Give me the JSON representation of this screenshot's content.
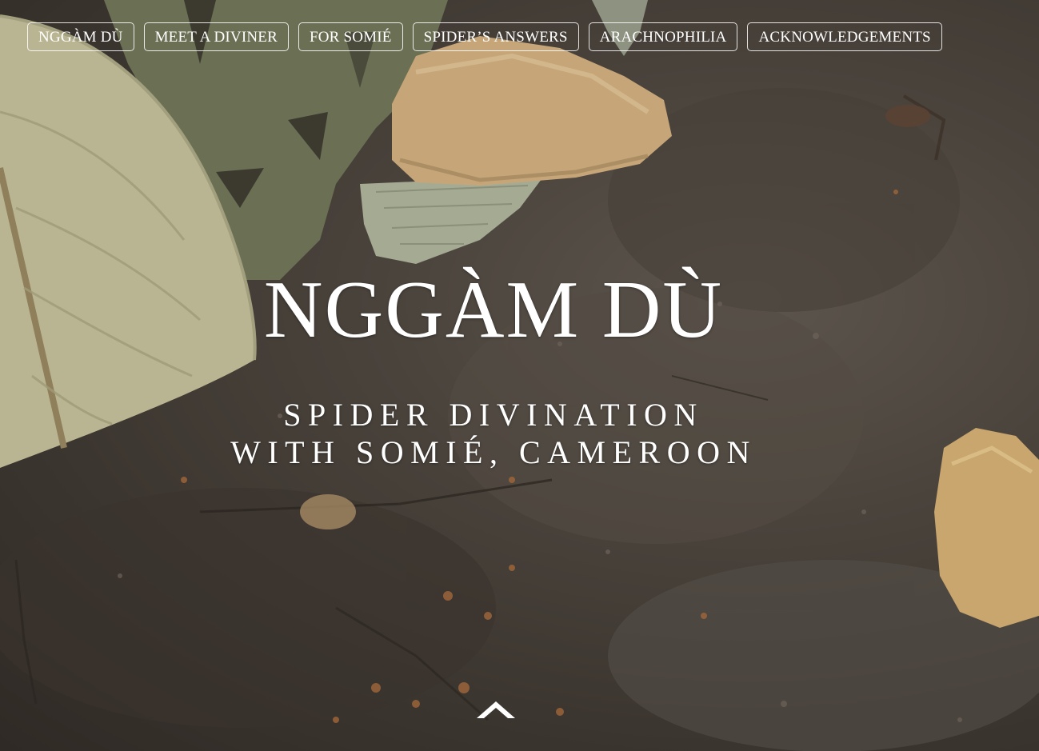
{
  "nav": {
    "items": [
      {
        "label": "NGGÀM DÙ"
      },
      {
        "label": "MEET A DIVINER"
      },
      {
        "label": "FOR SOMIÉ"
      },
      {
        "label": "SPIDER’S ANSWERS"
      },
      {
        "label": "ARACHNOPHILIA"
      },
      {
        "label": "ACKNOWLEDGEMENTS"
      }
    ]
  },
  "hero": {
    "title": "NGGÀM DÙ",
    "subtitle_line1": "SPIDER DIVINATION",
    "subtitle_line2": "WITH SOMIÉ, CAMEROON"
  },
  "icons": {
    "scroll": "chevron-up-icon"
  },
  "colors": {
    "text": "#ffffff",
    "soil": "#4a433c",
    "leaf_light": "#b8b592",
    "leaf_dark": "#6f7355",
    "rock": "#c9a874"
  }
}
